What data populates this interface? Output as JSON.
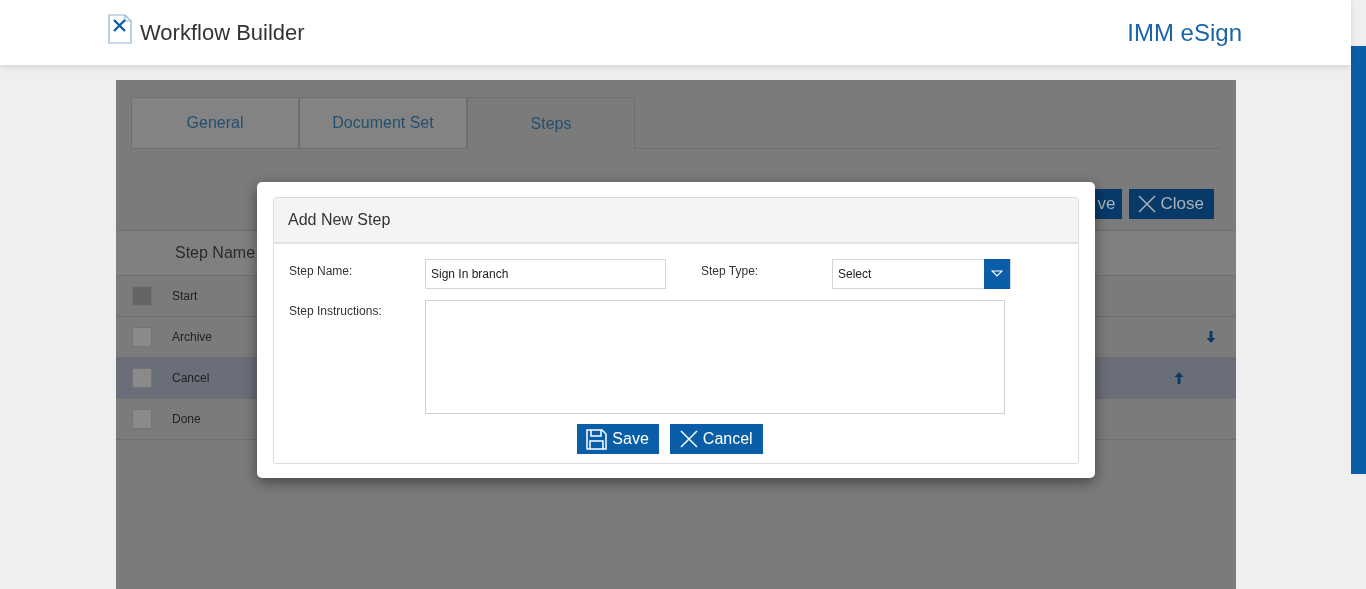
{
  "header": {
    "title": "Workflow Builder",
    "brand": "IMM eSign"
  },
  "tabs": [
    {
      "label": "General",
      "selected": false
    },
    {
      "label": "Document Set",
      "selected": false
    },
    {
      "label": "Steps",
      "selected": true
    }
  ],
  "toolbar": {
    "save_label": "ve",
    "close_label": "Close"
  },
  "table": {
    "columns": [
      "Step Name"
    ],
    "rows": [
      {
        "name": "Start",
        "selected": false,
        "disabled": true,
        "kind": "plain"
      },
      {
        "name": "Archive",
        "selected": false,
        "disabled": false,
        "kind": "down"
      },
      {
        "name": "Cancel",
        "selected": true,
        "disabled": false,
        "kind": "up"
      },
      {
        "name": "Done",
        "selected": false,
        "disabled": false,
        "kind": "plain"
      }
    ]
  },
  "dialog": {
    "title": "Add New Step",
    "step_name_label": "Step Name:",
    "step_name_value": "Sign In branch",
    "step_type_label": "Step Type:",
    "step_type_value": "Select",
    "instructions_label": "Step Instructions:",
    "save_label": "Save",
    "cancel_label": "Cancel"
  }
}
